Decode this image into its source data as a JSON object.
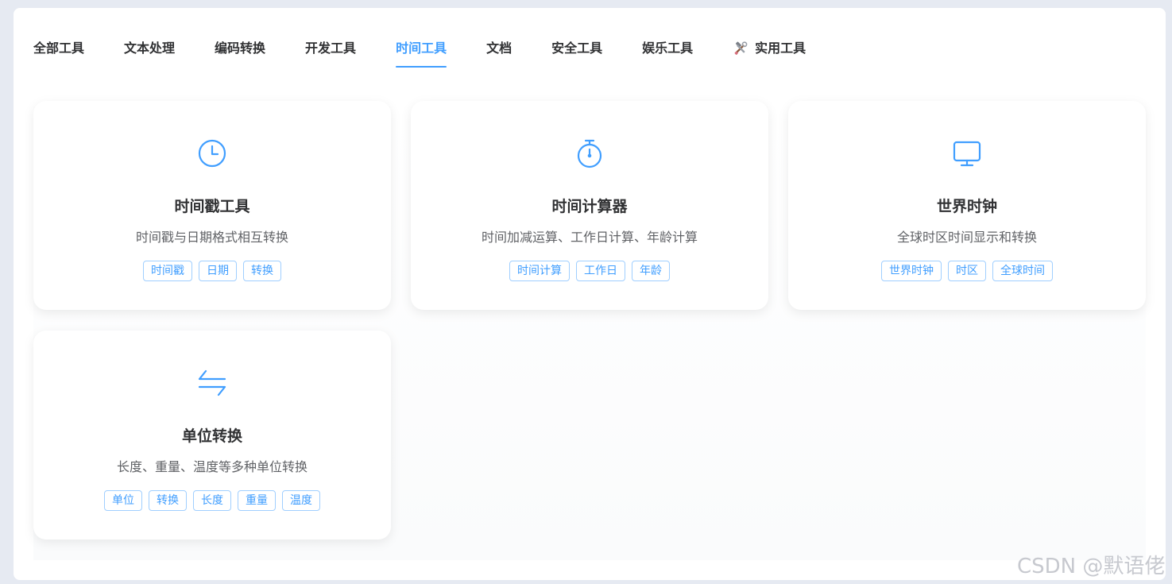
{
  "tabs": [
    {
      "label": "全部工具"
    },
    {
      "label": "文本处理"
    },
    {
      "label": "编码转换"
    },
    {
      "label": "开发工具"
    },
    {
      "label": "时间工具",
      "active": true
    },
    {
      "label": "文档"
    },
    {
      "label": "安全工具"
    },
    {
      "label": "娱乐工具"
    },
    {
      "label": "实用工具",
      "icon": "hammer-wrench-icon"
    }
  ],
  "cards": [
    {
      "icon": "clock-icon",
      "title": "时间戳工具",
      "desc": "时间戳与日期格式相互转换",
      "tags": [
        "时间戳",
        "日期",
        "转换"
      ]
    },
    {
      "icon": "stopwatch-icon",
      "title": "时间计算器",
      "desc": "时间加减运算、工作日计算、年龄计算",
      "tags": [
        "时间计算",
        "工作日",
        "年龄"
      ]
    },
    {
      "icon": "monitor-icon",
      "title": "世界时钟",
      "desc": "全球时区时间显示和转换",
      "tags": [
        "世界时钟",
        "时区",
        "全球时间"
      ]
    },
    {
      "icon": "switch-arrows-icon",
      "title": "单位转换",
      "desc": "长度、重量、温度等多种单位转换",
      "tags": [
        "单位",
        "转换",
        "长度",
        "重量",
        "温度"
      ]
    }
  ],
  "colors": {
    "accent": "#409eff",
    "text": "#303133",
    "muted": "#606266"
  },
  "watermark": "CSDN @默语佬"
}
